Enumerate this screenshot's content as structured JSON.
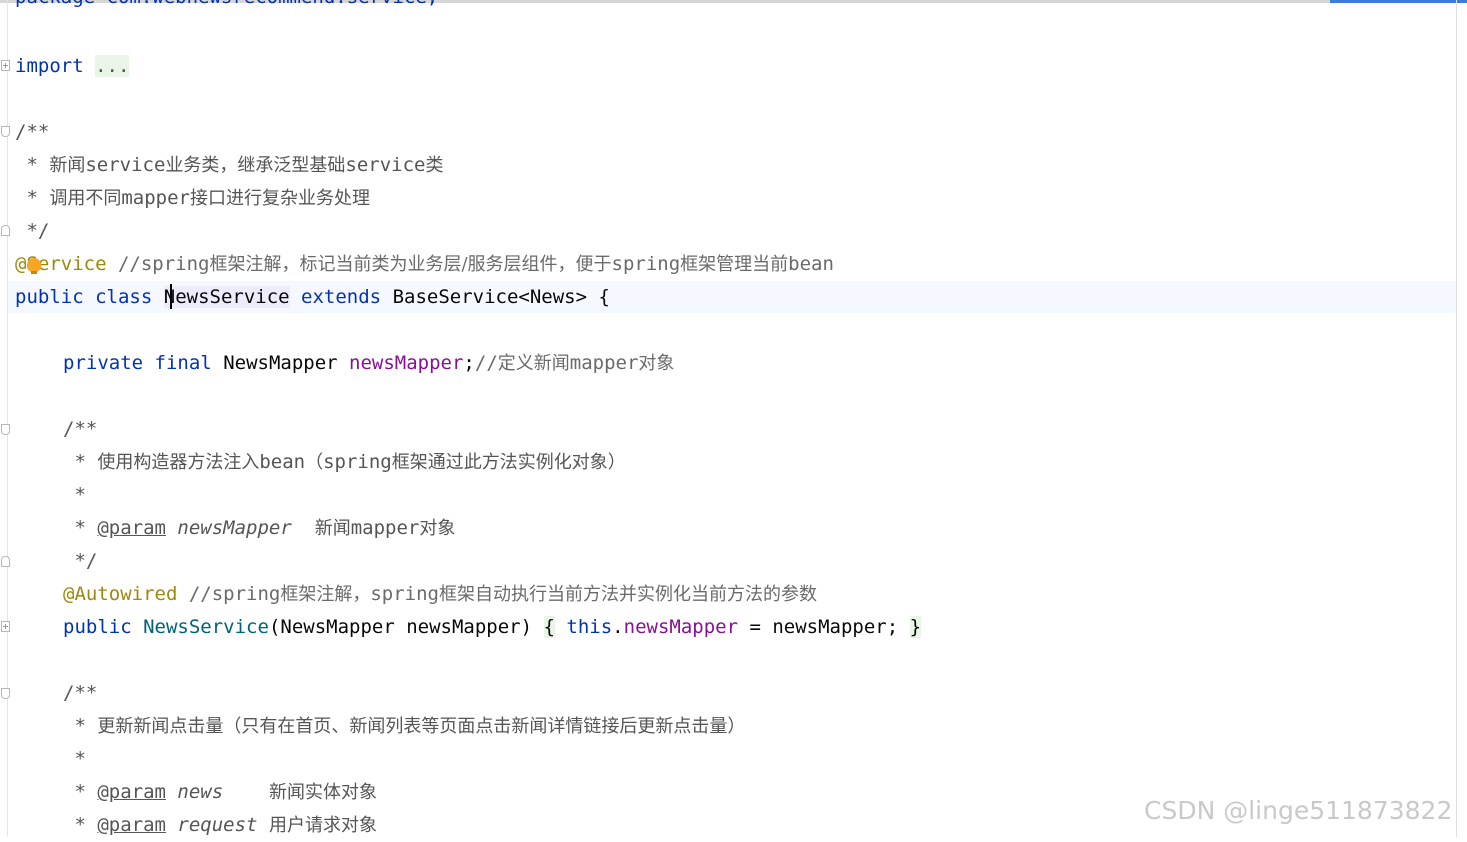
{
  "editor": {
    "top_clipped_line": "package com.webnewsrecommend.service;",
    "lines": {
      "import_kw": "import",
      "import_fold": "...",
      "doc_open": "/**",
      "doc1_star": " * ",
      "doc1_text_a": "新闻",
      "doc1_text_b": "service",
      "doc1_text_c": "业务类，继承泛型基础",
      "doc1_text_d": "service",
      "doc1_text_e": "类",
      "doc2_star": " * ",
      "doc2_text_a": "调用不同",
      "doc2_text_b": "mapper",
      "doc2_text_c": "接口进行复杂业务处理",
      "doc_close": " */",
      "service_ann": "@Service",
      "service_comment_a": " //spring",
      "service_comment_b": "框架注解，标记当前类为业务层/服务层组件，便于",
      "service_comment_c": "spring",
      "service_comment_d": "框架管理当前",
      "service_comment_e": "bean",
      "class_public": "public",
      "class_class": "class",
      "class_name": "NewsService",
      "class_extends": "extends",
      "class_base": "BaseService<News>",
      "class_brace": "{",
      "field_private": "private",
      "field_final": "final",
      "field_type": "NewsMapper",
      "field_name": "newsMapper",
      "field_semi": ";",
      "field_comment_a": "//",
      "field_comment_b": "定义新闻",
      "field_comment_c": "mapper",
      "field_comment_d": "对象",
      "doc3_open": "/**",
      "doc3_l1_star": " * ",
      "doc3_l1_a": "使用构造器方法注入",
      "doc3_l1_b": "bean",
      "doc3_l1_c": "（",
      "doc3_l1_d": "spring",
      "doc3_l1_e": "框架通过此方法实例化对象）",
      "doc3_l2": " *",
      "doc3_l3_star": " * ",
      "doc3_l3_tag": "@param",
      "doc3_l3_name": "newsMapper",
      "doc3_l3_a": "新闻",
      "doc3_l3_b": "mapper",
      "doc3_l3_c": "对象",
      "doc3_close": " */",
      "autowired_ann": "@Autowired",
      "autowired_comment_a": " //spring",
      "autowired_comment_b": "框架注解，",
      "autowired_comment_c": "spring",
      "autowired_comment_d": "框架自动执行当前方法并实例化当前方法的参数",
      "ctor_public": "public",
      "ctor_name": "NewsService",
      "ctor_params": "(NewsMapper newsMapper)",
      "ctor_open": "{",
      "ctor_this": "this",
      "ctor_dot": ".",
      "ctor_field": "newsMapper",
      "ctor_assign": " = newsMapper;",
      "ctor_close": "}",
      "doc4_open": "/**",
      "doc4_l1_star": " * ",
      "doc4_l1_text": "更新新闻点击量（只有在首页、新闻列表等页面点击新闻详情链接后更新点击量）",
      "doc4_l2": " *",
      "doc4_l3_star": " * ",
      "doc4_l3_tag": "@param",
      "doc4_l3_name": "news",
      "doc4_l3_text": "新闻实体对象",
      "doc4_l4_star": " * ",
      "doc4_l4_tag": "@param",
      "doc4_l4_name": "request",
      "doc4_l4_text": "用户请求对象"
    }
  },
  "watermark": "CSDN @linge511873822",
  "icons": {
    "intention": "lightbulb-icon",
    "fold": "fold-icon"
  },
  "colors": {
    "keyword": "#0033b3",
    "annotation": "#9e880d",
    "field": "#871094",
    "method": "#00627a",
    "comment": "#6a6a6a"
  }
}
